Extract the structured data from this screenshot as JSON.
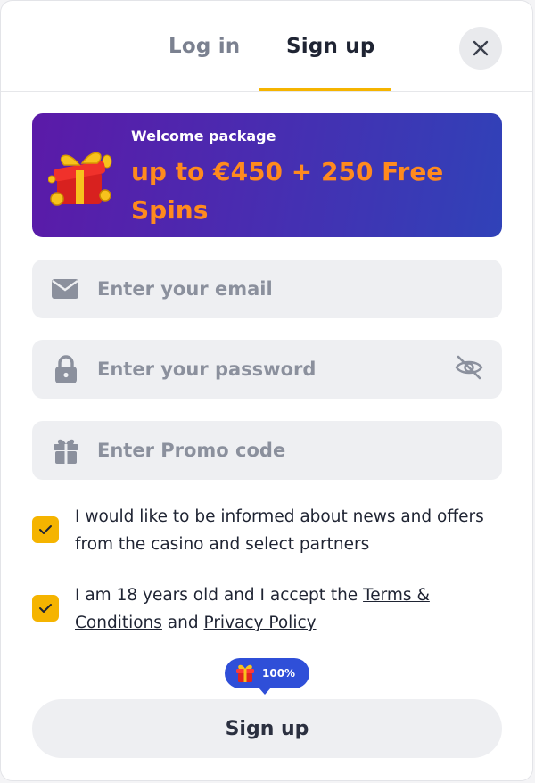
{
  "tabs": {
    "login": "Log in",
    "signup": "Sign up"
  },
  "banner": {
    "label": "Welcome package",
    "offer": "up to €450 + 250 Free Spins"
  },
  "fields": {
    "email_placeholder": "Enter your email",
    "password_placeholder": "Enter your password",
    "promo_placeholder": "Enter Promo code"
  },
  "consents": {
    "news": {
      "text": "I would like to be informed about news and offers from the casino and select partners",
      "checked": true
    },
    "age": {
      "prefix": "I am 18 years old and I accept the ",
      "terms_link": "Terms & Conditions",
      "middle": " and ",
      "privacy_link": "Privacy Policy",
      "checked": true
    }
  },
  "bonus_badge": {
    "percent": "100%"
  },
  "submit_label": "Sign up",
  "colors": {
    "accent": "#f5b400",
    "banner_start": "#5b1aa8",
    "banner_end": "#3042b8",
    "offer_text": "#ff8a1e",
    "badge": "#2f4fd8"
  },
  "icons": {
    "close": "close-icon",
    "gift_banner": "gift-box-icon",
    "email": "envelope-icon",
    "password": "lock-icon",
    "password_toggle": "eye-off-icon",
    "promo": "gift-icon",
    "checkbox": "checkmark-icon",
    "badge": "gift-icon"
  }
}
